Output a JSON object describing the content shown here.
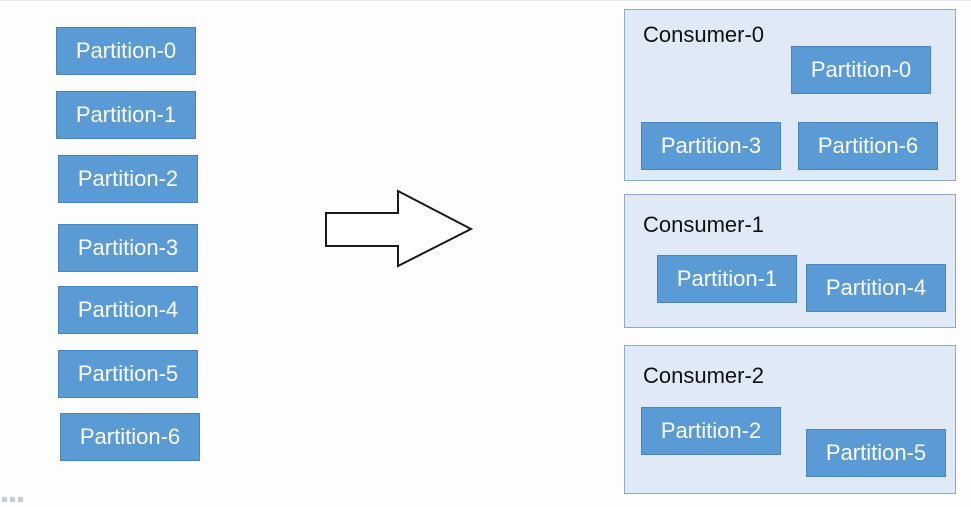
{
  "source_partitions": [
    "Partition-0",
    "Partition-1",
    "Partition-2",
    "Partition-3",
    "Partition-4",
    "Partition-5",
    "Partition-6"
  ],
  "consumers": [
    {
      "name": "Consumer-0",
      "partitions": [
        "Partition-0",
        "Partition-3",
        "Partition-6"
      ]
    },
    {
      "name": "Consumer-1",
      "partitions": [
        "Partition-1",
        "Partition-4"
      ]
    },
    {
      "name": "Consumer-2",
      "partitions": [
        "Partition-2",
        "Partition-5"
      ]
    }
  ],
  "colors": {
    "partition_fill": "#5b9bd5",
    "consumer_fill": "#dfeaf6",
    "consumer_border": "#8fa9c6"
  }
}
